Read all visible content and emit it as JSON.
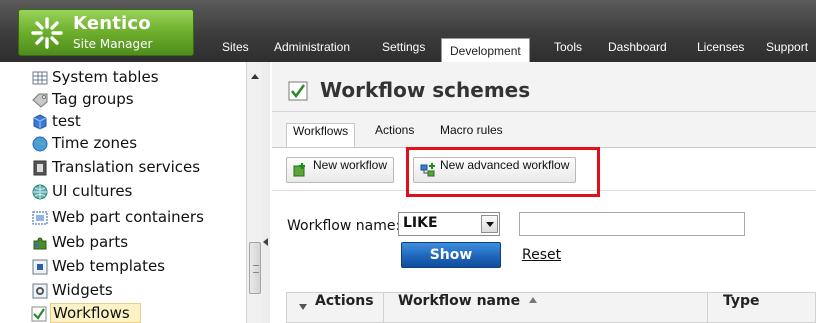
{
  "app": {
    "brand_name": "Kentico",
    "brand_subtitle": "Site Manager"
  },
  "menu": [
    {
      "label": "Sites"
    },
    {
      "label": "Administration"
    },
    {
      "label": "Settings"
    },
    {
      "label": "Development",
      "active": true
    },
    {
      "label": "Tools"
    },
    {
      "label": "Dashboard"
    },
    {
      "label": "Licenses"
    },
    {
      "label": "Support"
    }
  ],
  "tree": [
    {
      "label": "System tables",
      "icon": "table-icon"
    },
    {
      "label": "Tag groups",
      "icon": "tag-icon"
    },
    {
      "label": "test",
      "icon": "cube-icon"
    },
    {
      "label": "Time zones",
      "icon": "globe-clock-icon"
    },
    {
      "label": "Translation services",
      "icon": "translation-icon"
    },
    {
      "label": "UI cultures",
      "icon": "globe-icon"
    },
    {
      "label": "Web part containers",
      "icon": "container-icon"
    },
    {
      "label": "Web parts",
      "icon": "puzzle-icon"
    },
    {
      "label": "Web templates",
      "icon": "template-icon"
    },
    {
      "label": "Widgets",
      "icon": "widget-icon"
    },
    {
      "label": "Workflows",
      "icon": "checkmark-icon",
      "selected": true
    }
  ],
  "page": {
    "title": "Workflow schemes"
  },
  "tabs": [
    {
      "label": "Workflows",
      "active": true
    },
    {
      "label": "Actions"
    },
    {
      "label": "Macro rules"
    }
  ],
  "toolbar": {
    "new_workflow": "New workflow",
    "new_advanced_workflow": "New advanced workflow"
  },
  "filter": {
    "label": "Workflow name:",
    "operator": "LIKE",
    "value": "",
    "show_label": "Show",
    "reset_label": "Reset"
  },
  "grid": {
    "actions_header": "Actions",
    "name_header": "Workflow name",
    "type_header": "Type"
  },
  "colors": {
    "brand_green": "#6cae2c",
    "highlight_red": "#e0101a",
    "show_button_blue": "#1f66bb",
    "selected_row": "#fdf1c6"
  }
}
